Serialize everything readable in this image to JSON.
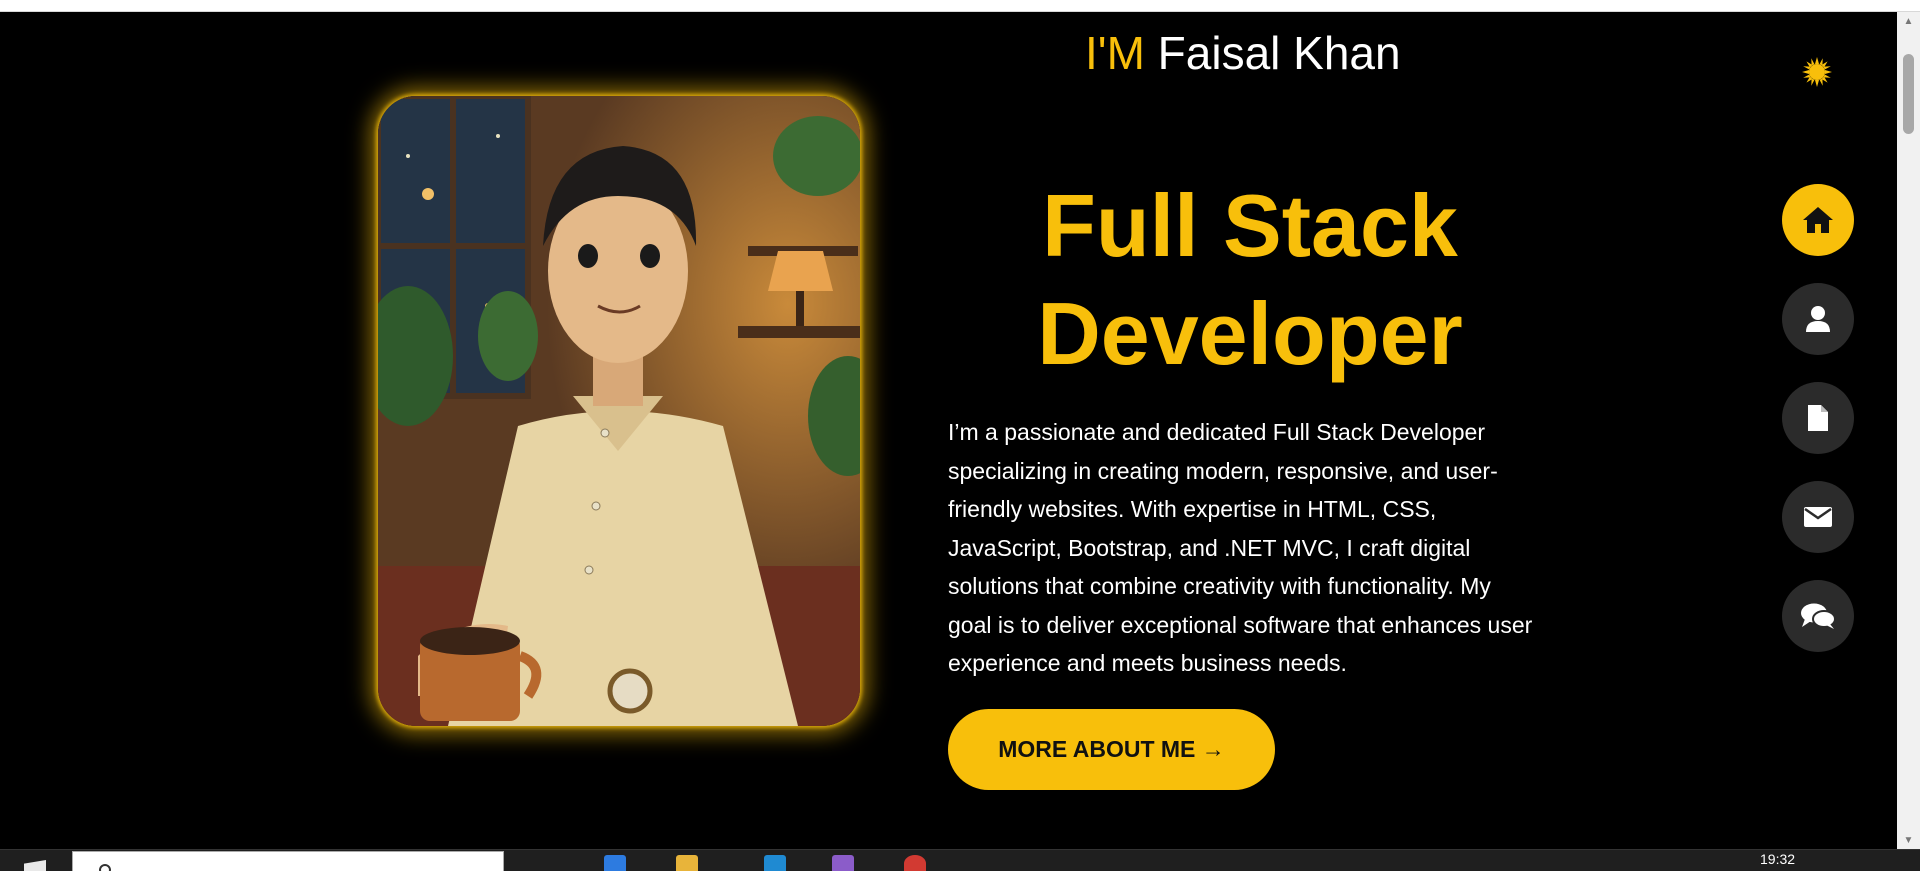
{
  "page": {
    "name_prefix": "I'M",
    "name": "Faisal Khan",
    "title_line1": "Full Stack",
    "title_line2": "Developer",
    "bio": "I’m a passionate and dedicated Full Stack Developer specializing in creating modern, responsive, and user-friendly websites. With expertise in HTML, CSS, JavaScript, Bootstrap, and .NET MVC, I craft digital solutions that combine creativity with functionality. My goal is to deliver exceptional software that enhances user experience and meets business needs.",
    "cta_label": "MORE ABOUT ME →"
  },
  "theme_toggle": {
    "icon": "sun-icon"
  },
  "sidenav": {
    "items": [
      {
        "icon": "home-icon",
        "active": true
      },
      {
        "icon": "user-icon",
        "active": false
      },
      {
        "icon": "document-icon",
        "active": false
      },
      {
        "icon": "envelope-icon",
        "active": false
      },
      {
        "icon": "chat-icon",
        "active": false
      }
    ]
  },
  "taskbar": {
    "clock": "19:32"
  },
  "colors": {
    "accent": "#f8bf0b",
    "background": "#000000",
    "nav_inactive": "#2b2b2b",
    "text": "#ffffff"
  }
}
